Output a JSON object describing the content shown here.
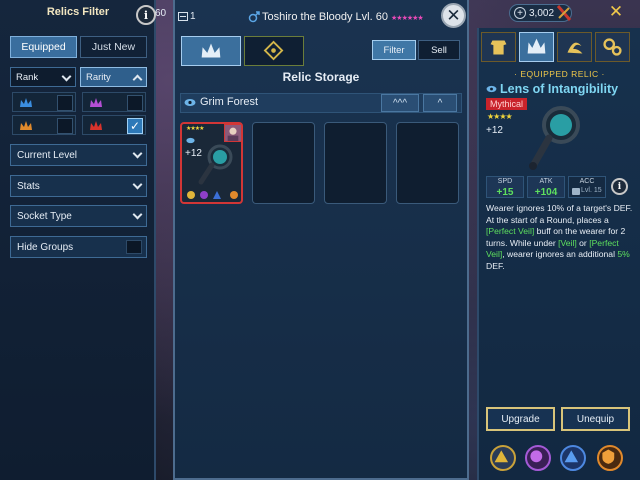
{
  "filter_panel": {
    "title": "Relics Filter",
    "tabs": [
      {
        "label": "Equipped",
        "active": true
      },
      {
        "label": "Just New",
        "active": false
      }
    ],
    "rank_label": "Rank",
    "rarity_label": "Rarity",
    "rank_colors": [
      "#3b8ee0",
      "#e08a2c"
    ],
    "rarity_colors": [
      "#b54fd6",
      "#d8332c"
    ],
    "rarity_checked": [
      false,
      true
    ],
    "dropdowns": [
      "Current Level",
      "Stats",
      "Socket Type"
    ],
    "hide_groups_label": "Hide Groups"
  },
  "top_bar": {
    "left_counter": "60",
    "storage_count": "1",
    "hero_title": "Toshiro the Bloody Lvl. 60",
    "hero_stars": "★★★★★★",
    "currency_value": "3,002"
  },
  "storage": {
    "filter_label": "Filter",
    "sell_label": "Sell",
    "title": "Relic Storage",
    "group_name": "Grim Forest",
    "group_btn_collapse": "^^^",
    "group_btn_up": "^",
    "slot_level": "+12",
    "slot_stars": "★★★★"
  },
  "detail": {
    "header": "· EQUIPPED RELIC ·",
    "name": "Lens of Intangibility",
    "rarity": "Mythical",
    "stars": "★★★★",
    "level": "+12",
    "stats": [
      {
        "label": "SPD",
        "value": "+15"
      },
      {
        "label": "ATK",
        "value": "+104"
      },
      {
        "label": "ACC",
        "value": "Lvl. 15"
      }
    ],
    "desc_parts": [
      {
        "text": "Wearer ignores 10% of a target's DEF. At the start of a Round, places a ",
        "green": false
      },
      {
        "text": "[Perfect Veil]",
        "green": true
      },
      {
        "text": " buff on the wearer for 2 turns. While under ",
        "green": false
      },
      {
        "text": "[Veil]",
        "green": true
      },
      {
        "text": " or ",
        "green": false
      },
      {
        "text": "[Perfect Veil]",
        "green": true
      },
      {
        "text": ", wearer ignores an additional ",
        "green": false
      },
      {
        "text": "5%",
        "green": true
      },
      {
        "text": " DEF.",
        "green": false
      }
    ],
    "upgrade_label": "Upgrade",
    "unequip_label": "Unequip"
  },
  "icons": {
    "info": "i",
    "close": "✕",
    "checkmark": "✓",
    "plus": "+"
  }
}
